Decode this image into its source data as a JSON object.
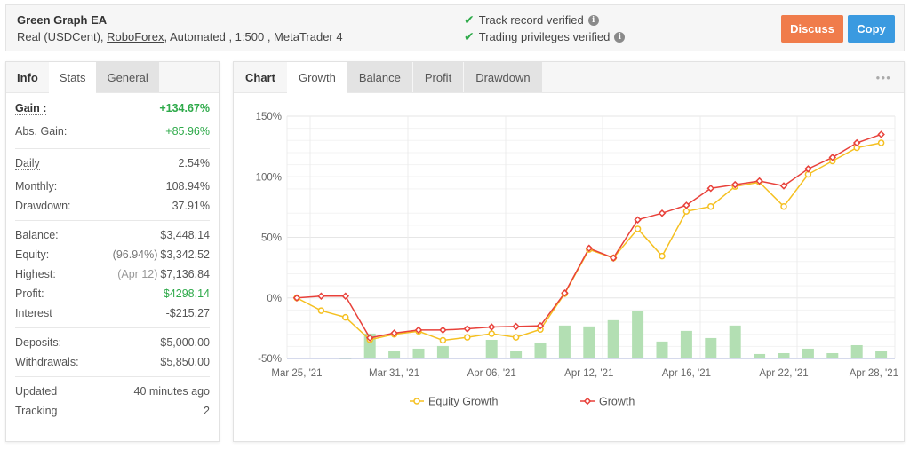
{
  "header": {
    "title": "Green Graph EA",
    "subtitle_prefix": "Real (USDCent),",
    "broker_link": "RoboForex",
    "subtitle_suffix": ", Automated , 1:500 , MetaTrader 4",
    "verifications": [
      {
        "icon": "check-icon",
        "label": "Track record verified",
        "info_icon": "info-icon"
      },
      {
        "icon": "check-icon",
        "label": "Trading privileges verified",
        "info_icon": "info-icon"
      }
    ],
    "discuss_label": "Discuss",
    "copy_label": "Copy",
    "colors": {
      "discuss": "#f07c4b",
      "copy": "#3a9ae0",
      "verified": "#2eaa4a"
    }
  },
  "left_panel": {
    "tabs": [
      {
        "label": "Info",
        "active": false
      },
      {
        "label": "Stats",
        "active": true
      },
      {
        "label": "General",
        "active": false
      }
    ],
    "gain": {
      "label": "Gain :",
      "value": "+134.67%"
    },
    "abs_gain": {
      "label": "Abs. Gain:",
      "value": "+85.96%"
    },
    "daily": {
      "label": "Daily",
      "value": "2.54%"
    },
    "monthly": {
      "label": "Monthly:",
      "value": "108.94%"
    },
    "drawdown": {
      "label": "Drawdown:",
      "value": "37.91%"
    },
    "balance": {
      "label": "Balance:",
      "value": "$3,448.14"
    },
    "equity": {
      "label": "Equity:",
      "note": "(96.94%)",
      "value": "$3,342.52"
    },
    "highest": {
      "label": "Highest:",
      "note": "(Apr 12)",
      "value": "$7,136.84"
    },
    "profit": {
      "label": "Profit:",
      "value": "$4298.14"
    },
    "interest": {
      "label": "Interest",
      "value": "-$215.27"
    },
    "deposits": {
      "label": "Deposits:",
      "value": "$5,000.00"
    },
    "withdrawals": {
      "label": "Withdrawals:",
      "value": "$5,850.00"
    },
    "updated": {
      "label": "Updated",
      "value": "40 minutes ago"
    },
    "tracking": {
      "label": "Tracking",
      "value": "2"
    }
  },
  "right_panel": {
    "tabs": [
      {
        "label": "Chart",
        "active": false
      },
      {
        "label": "Growth",
        "active": true
      },
      {
        "label": "Balance",
        "active": false
      },
      {
        "label": "Profit",
        "active": false
      },
      {
        "label": "Drawdown",
        "active": false
      }
    ],
    "more_icon": "more-dots-icon",
    "more_glyph": "●●●"
  },
  "chart_data": {
    "type": "line",
    "title": "",
    "xlabel": "",
    "ylabel": "",
    "ylim": [
      -50,
      150
    ],
    "yticks": [
      "150%",
      "100%",
      "50%",
      "0%",
      "-50%"
    ],
    "ytick_values": [
      150,
      100,
      50,
      0,
      -50
    ],
    "xtick_labels": [
      "Mar 25, '21",
      "Mar 31, '21",
      "Apr 06, '21",
      "Apr 12, '21",
      "Apr 16, '21",
      "Apr 22, '21",
      "Apr 28, '21"
    ],
    "xtick_indices": [
      0,
      4,
      8,
      12,
      16,
      20,
      23.7
    ],
    "grid": true,
    "legend_position": "bottom",
    "series": [
      {
        "name": "Equity Growth",
        "color": "#f5c021",
        "marker": "circle",
        "values": [
          0,
          -10.5,
          -16,
          -34.5,
          -30,
          -27.5,
          -35,
          -32.5,
          -29.5,
          -32.5,
          -26,
          3.5,
          40,
          33,
          57,
          34.5,
          71.5,
          75.5,
          92,
          95.5,
          75.5,
          102,
          113,
          124,
          128
        ]
      },
      {
        "name": "Growth",
        "color": "#e8413a",
        "marker": "diamond",
        "values": [
          0,
          1.5,
          1.5,
          -33,
          -29,
          -26.5,
          -26.5,
          -25.5,
          -24,
          -23.5,
          -23,
          4,
          41,
          33,
          64.5,
          70,
          76.5,
          90.5,
          93.5,
          96.5,
          92.5,
          106.5,
          116,
          128,
          135
        ]
      }
    ],
    "bars": {
      "color": "#b3dfb3",
      "note": "bar tops read on the % axis, drawn up from the -50% baseline",
      "values": [
        null,
        -49.3,
        -50,
        -29.4,
        -43.4,
        -41.9,
        -39.7,
        -49.3,
        -34.6,
        -44.1,
        -36.8,
        -22.8,
        -23.5,
        -18.4,
        -11,
        -36,
        -27.2,
        -33.1,
        -22.8,
        -46.3,
        -45.6,
        -41.9,
        -45.6,
        -39,
        -44.1
      ]
    }
  }
}
